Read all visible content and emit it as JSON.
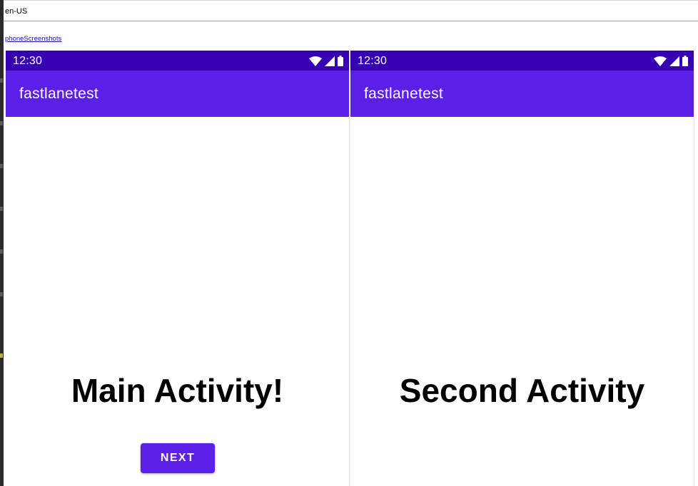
{
  "header": {
    "locale": "en-US"
  },
  "section": {
    "link_label": "phoneScreenshots"
  },
  "colors": {
    "status_bar": "#3700b3",
    "app_bar": "#5c1fe8",
    "button": "#5c1fe8"
  },
  "screenshots": [
    {
      "status": {
        "time": "12:30",
        "icons": [
          "wifi-icon",
          "signal-icon",
          "battery-icon"
        ]
      },
      "app_bar": {
        "title": "fastlanetest"
      },
      "content": {
        "title": "Main Activity!"
      },
      "button": {
        "label": "NEXT"
      }
    },
    {
      "status": {
        "time": "12:30",
        "icons": [
          "wifi-icon",
          "signal-icon",
          "battery-icon"
        ]
      },
      "app_bar": {
        "title": "fastlanetest"
      },
      "content": {
        "title": "Second Activity"
      }
    }
  ]
}
